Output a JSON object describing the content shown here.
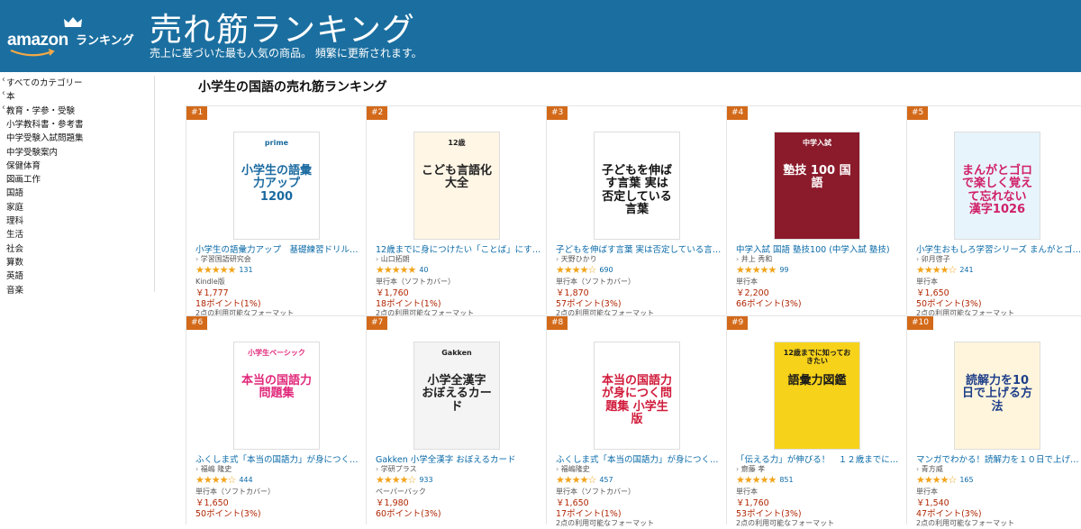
{
  "header": {
    "logo_amazon": "amazon",
    "logo_ranking": "ランキング",
    "title": "売れ筋ランキング",
    "subtitle": "売上に基づいた最も人気の商品。 頻繁に更新されます。",
    "background": "#1b6fa0"
  },
  "sidebar": {
    "categories": [
      {
        "label": "すべてのカテゴリー",
        "back": true
      },
      {
        "label": "本",
        "back": true
      },
      {
        "label": "教育・学参・受験",
        "back": true
      },
      {
        "label": "小学教科書・参考書",
        "back": false
      },
      {
        "label": "中学受験入試問題集",
        "back": false
      },
      {
        "label": "中学受験案内",
        "back": false
      },
      {
        "label": "保健体育",
        "back": false
      },
      {
        "label": "図画工作",
        "back": false
      },
      {
        "label": "国語",
        "back": false
      },
      {
        "label": "家庭",
        "back": false
      },
      {
        "label": "理科",
        "back": false
      },
      {
        "label": "生活",
        "back": false
      },
      {
        "label": "社会",
        "back": false
      },
      {
        "label": "算数",
        "back": false
      },
      {
        "label": "英語",
        "back": false
      },
      {
        "label": "音楽",
        "back": false
      }
    ]
  },
  "main": {
    "heading": "小学生の国語の売れ筋ランキング",
    "products": [
      {
        "rank": "#1",
        "title": "小学生の語彙力アップ　基礎練習ドリル120...",
        "author": "学習国語研究会",
        "stars": "★★★★★",
        "rating": 4.5,
        "reviews": "131",
        "format": "Kindle版",
        "price": "￥1,777",
        "points": "18ポイント(1%)",
        "other": "2点の利用可能なフォーマット",
        "cover_text": "小学生の語彙力アップ 1200",
        "cover_label": "prime",
        "cover_bg": "#ffffff",
        "cover_fg": "#1a6aa0"
      },
      {
        "rank": "#2",
        "title": "12歳までに身につけたい「ことば」にする力...",
        "author": "山口拓朗",
        "stars": "★★★★★",
        "rating": 4.5,
        "reviews": "40",
        "format": "単行本（ソフトカバー）",
        "price": "￥1,760",
        "points": "18ポイント(1%)",
        "other": "2点の利用可能なフォーマット",
        "cover_text": "こども言語化大全",
        "cover_label": "12歳",
        "cover_bg": "#fff6e6",
        "cover_fg": "#222222"
      },
      {
        "rank": "#3",
        "title": "子どもを伸ばす言葉 実は否定している言葉...",
        "author": "天野ひかり",
        "stars": "★★★★☆",
        "rating": 4.2,
        "reviews": "690",
        "format": "単行本（ソフトカバー）",
        "price": "￥1,870",
        "points": "57ポイント(3%)",
        "other": "2点の利用可能なフォーマット",
        "cover_text": "子どもを伸ばす言葉 実は否定している言葉",
        "cover_label": "",
        "cover_bg": "#ffffff",
        "cover_fg": "#111111"
      },
      {
        "rank": "#4",
        "title": "中学入試 国語 塾技100 (中学入試 塾技)",
        "author": "井上 秀和",
        "stars": "★★★★★",
        "rating": 4.5,
        "reviews": "99",
        "format": "単行本",
        "price": "￥2,200",
        "points": "66ポイント(3%)",
        "other": "",
        "cover_text": "塾技 100 国語",
        "cover_label": "中学入試",
        "cover_bg": "#8b1a2a",
        "cover_fg": "#ffffff"
      },
      {
        "rank": "#5",
        "title": "小学生おもしろ学習シリーズ まんがとゴロで...",
        "author": "卯月啓子",
        "stars": "★★★★☆",
        "rating": 4.3,
        "reviews": "241",
        "format": "単行本",
        "price": "￥1,650",
        "points": "50ポイント(3%)",
        "other": "2点の利用可能なフォーマット",
        "cover_text": "まんがとゴロで楽しく覚えて忘れない 漢字1026",
        "cover_label": "",
        "cover_bg": "#e8f4fb",
        "cover_fg": "#d0206a"
      },
      {
        "rank": "#6",
        "title": "ふくしま式「本当の国語力」が身につく問題...",
        "author": "福嶋 隆史",
        "stars": "★★★★☆",
        "rating": 4.3,
        "reviews": "444",
        "format": "単行本（ソフトカバー）",
        "price": "￥1,650",
        "points": "50ポイント(3%)",
        "other": "",
        "cover_text": "本当の国語力 問題集",
        "cover_label": "小学生ベーシック",
        "cover_bg": "#ffffff",
        "cover_fg": "#e0287a"
      },
      {
        "rank": "#7",
        "title": "Gakken 小学全漢字 おぼえるカード",
        "author": "学研プラス",
        "stars": "★★★★☆",
        "rating": 4.4,
        "reviews": "933",
        "format": "ペーパーバック",
        "price": "￥1,980",
        "points": "60ポイント(3%)",
        "other": "",
        "cover_text": "小学全漢字 おぼえるカード",
        "cover_label": "Gakken",
        "cover_bg": "#f4f4f4",
        "cover_fg": "#222222"
      },
      {
        "rank": "#8",
        "title": "ふくしま式「本当の国語力」が身につく問題...",
        "author": "福嶋隆史",
        "stars": "★★★★☆",
        "rating": 4.2,
        "reviews": "457",
        "format": "単行本（ソフトカバー）",
        "price": "￥1,650",
        "points": "17ポイント(1%)",
        "other": "2点の利用可能なフォーマット",
        "cover_text": "本当の国語力が身につく問題集 小学生版",
        "cover_label": "",
        "cover_bg": "#ffffff",
        "cover_fg": "#d01a3a"
      },
      {
        "rank": "#9",
        "title": "「伝える力」が伸びる！　１２歳までに知っ...",
        "author": "齋藤 孝",
        "stars": "★★★★★",
        "rating": 4.5,
        "reviews": "851",
        "format": "単行本",
        "price": "￥1,760",
        "points": "53ポイント(3%)",
        "other": "2点の利用可能なフォーマット",
        "cover_text": "語彙力図鑑",
        "cover_label": "12歳までに知っておきたい",
        "cover_bg": "#f7d21a",
        "cover_fg": "#1a1a1a"
      },
      {
        "rank": "#10",
        "title": "マンガでわかる！読解力を１０日で上げる方...",
        "author": "青方威",
        "stars": "★★★★☆",
        "rating": 4.3,
        "reviews": "165",
        "format": "単行本",
        "price": "￥1,540",
        "points": "47ポイント(3%)",
        "other": "2点の利用可能なフォーマット",
        "cover_text": "読解力を10日で上げる方法",
        "cover_label": "",
        "cover_bg": "#fff5dc",
        "cover_fg": "#1e3f8a"
      }
    ]
  },
  "colors": {
    "rank_badge": "#d36a1a",
    "link": "#0a6aa8",
    "price": "#b12704",
    "star": "#f2a41a"
  }
}
